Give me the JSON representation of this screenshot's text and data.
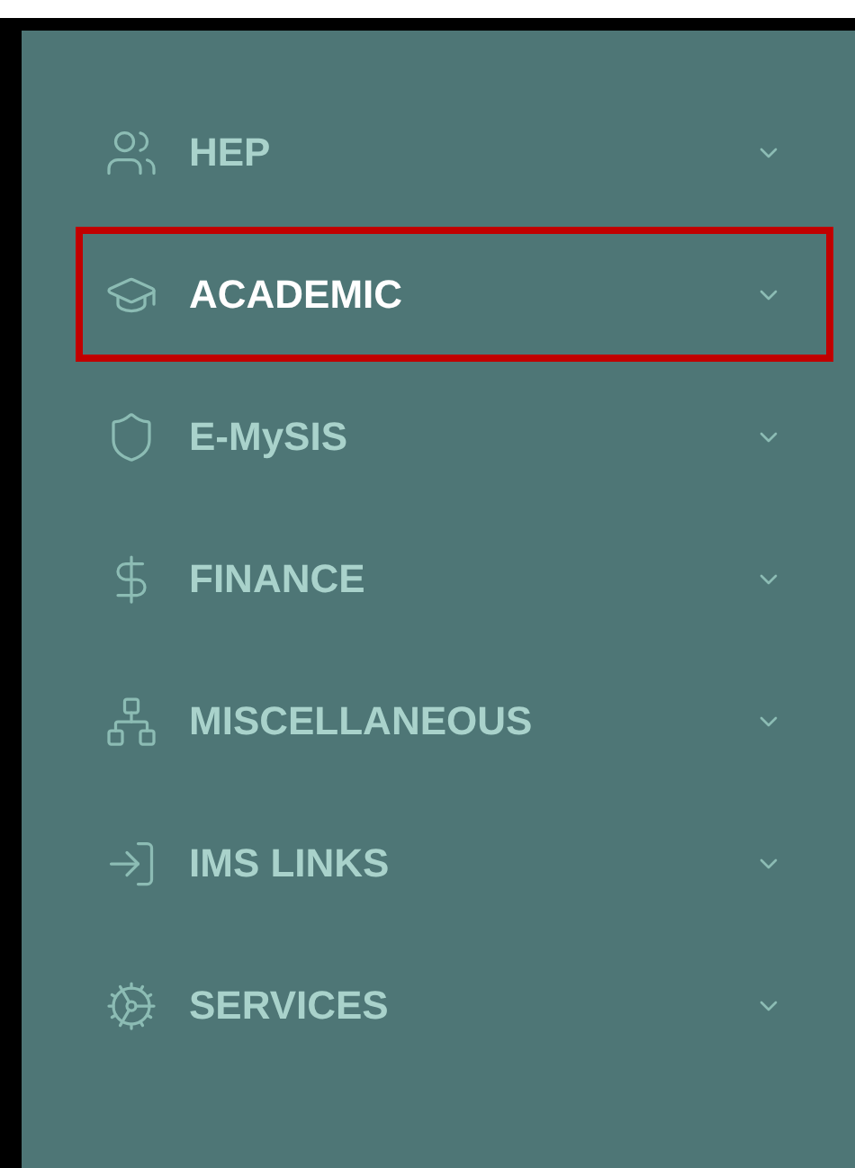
{
  "sidebar": {
    "items": [
      {
        "label": "HEP",
        "selected": false,
        "highlighted": false,
        "expanded": false
      },
      {
        "label": "ACADEMIC",
        "selected": true,
        "highlighted": true,
        "expanded": false
      },
      {
        "label": "E-MySIS",
        "selected": false,
        "highlighted": false,
        "expanded": false
      },
      {
        "label": "FINANCE",
        "selected": false,
        "highlighted": false,
        "expanded": false
      },
      {
        "label": "MISCELLANEOUS",
        "selected": false,
        "highlighted": false,
        "expanded": false
      },
      {
        "label": "IMS LINKS",
        "selected": false,
        "highlighted": false,
        "expanded": false
      },
      {
        "label": "SERVICES",
        "selected": false,
        "highlighted": false,
        "expanded": false
      }
    ]
  }
}
